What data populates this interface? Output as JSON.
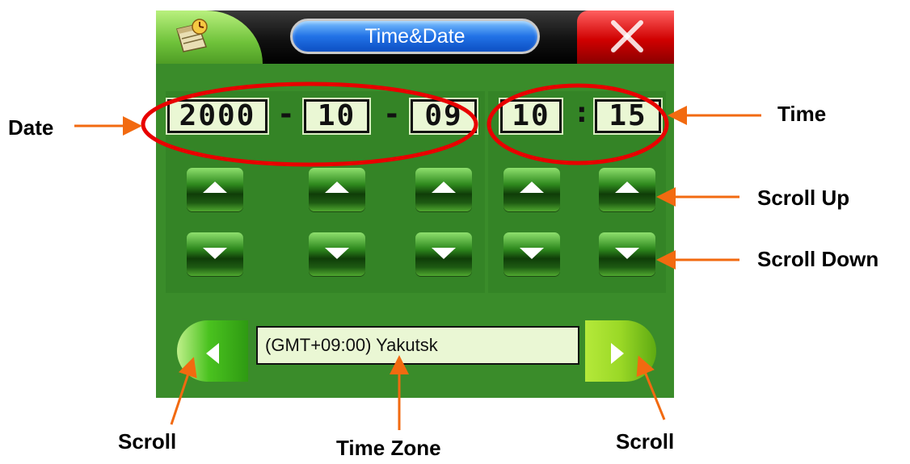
{
  "window": {
    "title": "Time&Date",
    "app_icon": "calendar-clock-icon",
    "close_icon": "close-icon"
  },
  "date": {
    "year": "2000",
    "separator_1": "-",
    "month": "10",
    "separator_2": "-",
    "day": "09"
  },
  "time": {
    "hour": "10",
    "separator": ":",
    "minute": "15"
  },
  "spinners": {
    "up_icon": "triangle-up-icon",
    "down_icon": "triangle-down-icon"
  },
  "timezone": {
    "value": "(GMT+09:00) Yakutsk",
    "prev_icon": "triangle-left-icon",
    "next_icon": "triangle-right-icon"
  },
  "annotations": {
    "date": "Date",
    "time": "Time",
    "scroll_up": "Scroll Up",
    "scroll_down": "Scroll Down",
    "scroll_left": "Scroll",
    "time_zone": "Time Zone",
    "scroll_right": "Scroll"
  },
  "colors": {
    "device_background": "#3a8c2a",
    "annotation": "#f26a10",
    "title_pill": "#2272e6",
    "close_button": "#d00000"
  }
}
